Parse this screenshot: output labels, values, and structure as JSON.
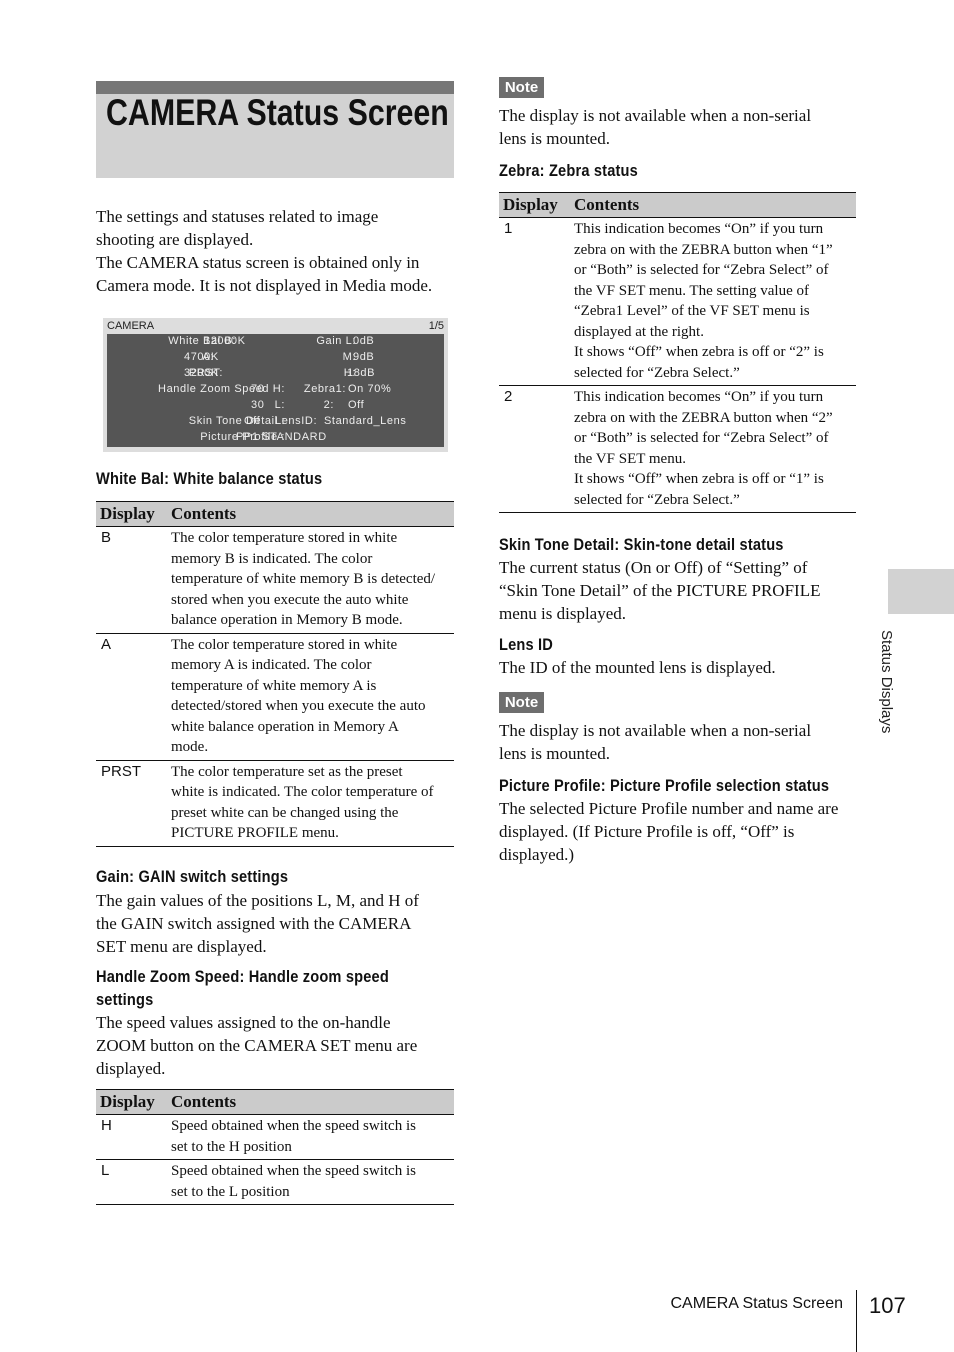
{
  "title": "CAMERA Status Screen",
  "intro": "The settings and statuses related to image\nshooting are displayed.\nThe CAMERA status screen is obtained only in\nCamera mode. It is not displayed in Media mode.",
  "screen": {
    "header": "CAMERA",
    "page": "1/5",
    "rows": [
      [
        "White  Bal  B:",
        "12000K",
        "Gain  L:",
        "0dB"
      ],
      [
        "A:",
        "4700K",
        "M:",
        "9dB"
      ],
      [
        "PRST:",
        "3200K",
        "H:",
        "18dB"
      ],
      [
        "Handle  Zoom  Speed  H:",
        "70",
        "Zebra1:",
        "On     70%"
      ],
      [
        "L:",
        "30",
        "2:",
        "Off"
      ],
      [
        "Skin  Tone  Detail :",
        "Off",
        "LensID:",
        "Standard_Lens"
      ],
      [
        "Picture  Profile   :",
        "PP1 STANDARD",
        "",
        ""
      ]
    ]
  },
  "white_bal": {
    "heading": "White Bal: White balance status",
    "headers": [
      "Display",
      "Contents"
    ],
    "rows": [
      [
        "B",
        "The color temperature stored in white\nmemory B is indicated. The color\ntemperature of white memory B is detected/\nstored when you execute the auto white\nbalance operation in Memory B mode."
      ],
      [
        "A",
        "The color temperature stored in white\nmemory A is indicated. The color\ntemperature of white memory A is\ndetected/stored when you execute the auto\nwhite balance operation in Memory A\nmode."
      ],
      [
        "PRST",
        "The color temperature set as the preset\nwhite is indicated. The color temperature of\npreset white can be changed using the\nPICTURE PROFILE menu."
      ]
    ]
  },
  "gain": {
    "heading": "Gain: GAIN switch settings",
    "text": "The gain values of the positions L, M, and H of\nthe GAIN switch assigned with the CAMERA\nSET menu are displayed."
  },
  "handle_zoom": {
    "heading": "Handle Zoom Speed: Handle zoom speed\nsettings",
    "text": "The speed values assigned to the on-handle\nZOOM button on the CAMERA SET menu are\ndisplayed.",
    "headers": [
      "Display",
      "Contents"
    ],
    "rows": [
      [
        "H",
        "Speed obtained when the speed switch is\nset to the H position"
      ],
      [
        "L",
        "Speed obtained when the speed switch is\nset to the L position"
      ]
    ]
  },
  "note1": {
    "label": "Note",
    "text": "The display is not available when a non-serial\nlens is mounted."
  },
  "zebra": {
    "heading": "Zebra: Zebra status",
    "headers": [
      "Display",
      "Contents"
    ],
    "rows": [
      [
        "1",
        "This indication becomes “On” if you turn\nzebra on with the ZEBRA button when “1”\nor “Both” is selected for “Zebra Select” of\nthe VF SET menu. The setting value of\n“Zebra1 Level” of the VF SET menu is\ndisplayed at the right.\nIt shows “Off” when zebra is off or “2” is\nselected for “Zebra Select.”"
      ],
      [
        "2",
        "This indication becomes “On” if you turn\nzebra on with the ZEBRA button when “2”\nor “Both” is selected for “Zebra Select” of\nthe VF SET menu.\nIt shows “Off” when zebra is off or “1” is\nselected for “Zebra Select.”"
      ]
    ]
  },
  "skin": {
    "heading": "Skin Tone Detail: Skin-tone detail status",
    "text": "The current status (On or Off) of “Setting” of\n“Skin Tone Detail” of the PICTURE PROFILE\nmenu is displayed."
  },
  "lens": {
    "heading": "Lens ID",
    "text": "The ID of the mounted lens is displayed."
  },
  "note2": {
    "label": "Note",
    "text": "The display is not available when a non-serial\nlens is mounted."
  },
  "profile": {
    "heading": "Picture Profile: Picture Profile selection status",
    "text": "The selected Picture Profile number and name are\ndisplayed. (If Picture Profile is off, “Off” is\ndisplayed.)"
  },
  "side_tab": "Status Displays",
  "footer": {
    "section": "CAMERA Status Screen",
    "page": "107"
  }
}
